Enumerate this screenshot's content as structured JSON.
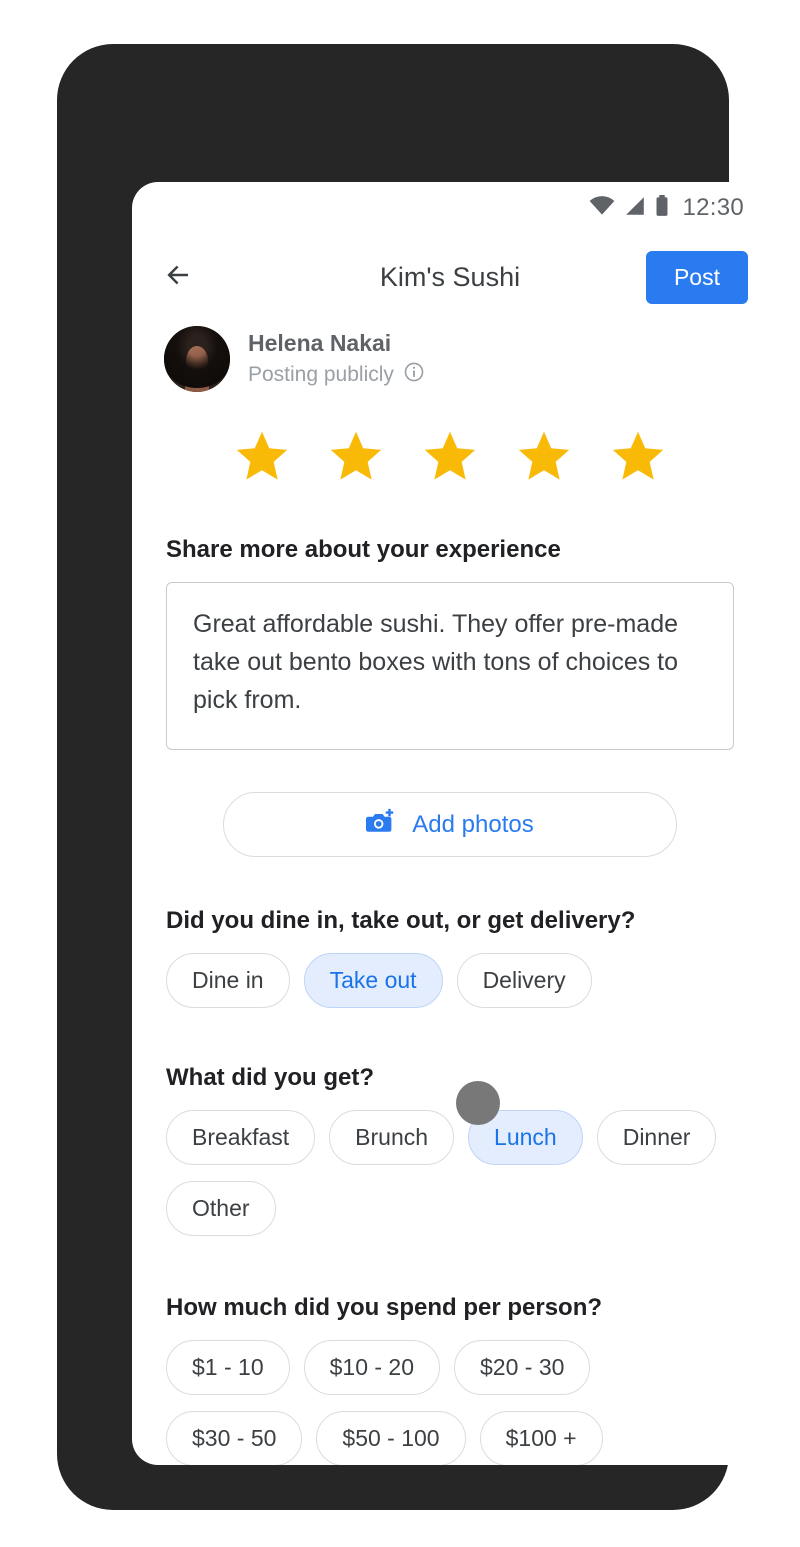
{
  "status_bar": {
    "time": "12:30",
    "icons": [
      "wifi-icon",
      "cell-signal-icon",
      "battery-icon"
    ]
  },
  "app_bar": {
    "back_icon": "back-arrow-icon",
    "title": "Kim's Sushi",
    "post_label": "Post",
    "post_color": "#2a7bf0"
  },
  "author": {
    "name": "Helena Nakai",
    "visibility": "Posting publicly",
    "info_icon": "info-icon",
    "avatar": "user-avatar"
  },
  "rating": {
    "value": 5,
    "max": 5,
    "star_color": "#f9b залишок"
  },
  "rating_stars": {
    "filled": 5,
    "total": 5,
    "color": "#f9ba07"
  },
  "review": {
    "label": "Share more about your experience",
    "text": "Great affordable sushi. They offer pre-made take out bento boxes with tons of choices to pick from.",
    "placeholder": "Share more about your experience"
  },
  "add_photos": {
    "label": "Add photos",
    "icon": "add-photo-camera-icon",
    "color": "#2a7bf0"
  },
  "questions": [
    {
      "id": "service",
      "title": "Did you dine in, take out, or get delivery?",
      "options": [
        {
          "label": "Dine in",
          "selected": false
        },
        {
          "label": "Take out",
          "selected": true
        },
        {
          "label": "Delivery",
          "selected": false
        }
      ]
    },
    {
      "id": "meal",
      "title": "What did you get?",
      "options": [
        {
          "label": "Breakfast",
          "selected": false
        },
        {
          "label": "Brunch",
          "selected": false
        },
        {
          "label": "Lunch",
          "selected": true
        },
        {
          "label": "Dinner",
          "selected": false
        },
        {
          "label": "Other",
          "selected": false
        }
      ]
    },
    {
      "id": "spend",
      "title": "How much did you spend per person?",
      "options": [
        {
          "label": "$1 - 10",
          "selected": false
        },
        {
          "label": "$10 - 20",
          "selected": false
        },
        {
          "label": "$20 - 30",
          "selected": false
        },
        {
          "label": "$30 - 50",
          "selected": false
        },
        {
          "label": "$50 - 100",
          "selected": false
        },
        {
          "label": "$100 +",
          "selected": false
        }
      ]
    }
  ],
  "touch_indicator": {
    "target": "Lunch"
  },
  "colors": {
    "accent_blue": "#2a7bf0",
    "chip_selected_bg": "#e4edfd",
    "chip_border": "#dadce0",
    "star": "#f9ba07",
    "frame": "#262626"
  }
}
